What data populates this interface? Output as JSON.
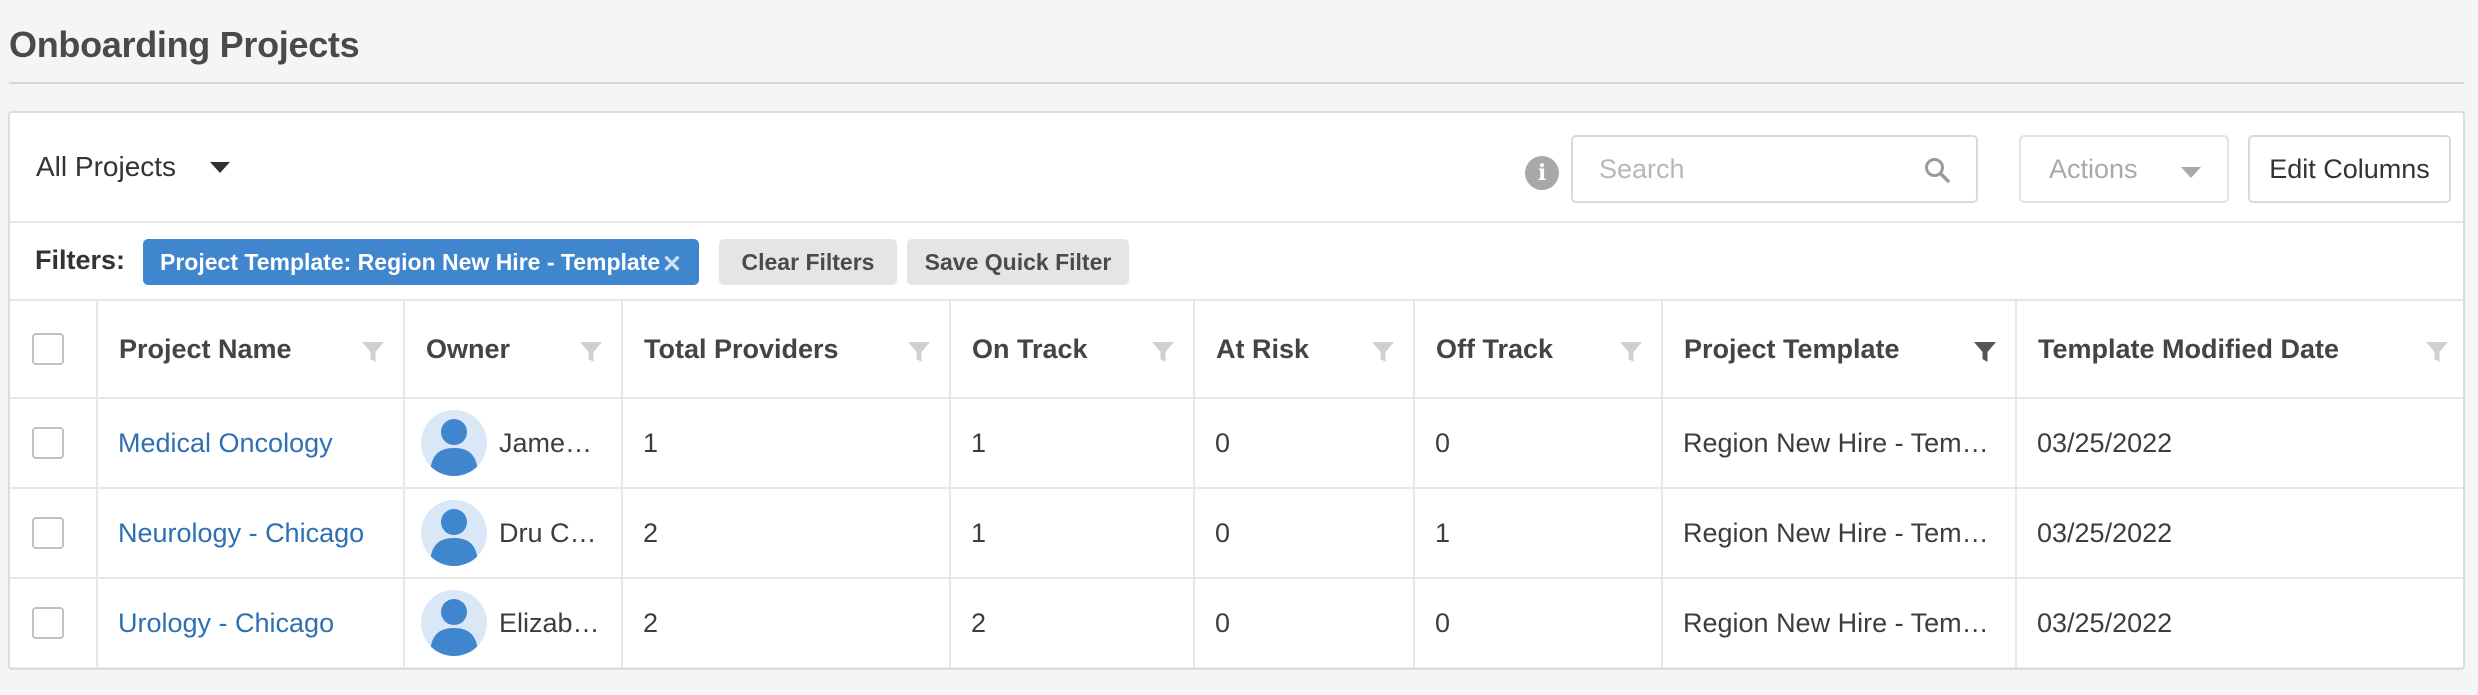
{
  "page": {
    "title": "Onboarding Projects"
  },
  "toolbar": {
    "view_label": "All Projects",
    "search_placeholder": "Search",
    "actions_label": "Actions",
    "edit_columns_label": "Edit Columns"
  },
  "filters": {
    "label": "Filters:",
    "active_chip": "Project Template: Region New Hire - Template",
    "chip_close": "✕",
    "clear_label": "Clear Filters",
    "save_label": "Save Quick Filter"
  },
  "table": {
    "columns": [
      "Project Name",
      "Owner",
      "Total Providers",
      "On Track",
      "At Risk",
      "Off Track",
      "Project Template",
      "Template Modified Date"
    ],
    "active_filter_column": "Project Template",
    "rows": [
      {
        "project_name": "Medical Oncology",
        "owner": "Jame…",
        "total_providers": "1",
        "on_track": "1",
        "at_risk": "0",
        "off_track": "0",
        "project_template": "Region New Hire - Tem…",
        "template_modified_date": "03/25/2022"
      },
      {
        "project_name": "Neurology - Chicago",
        "owner": "Dru C…",
        "total_providers": "2",
        "on_track": "1",
        "at_risk": "0",
        "off_track": "1",
        "project_template": "Region New Hire - Tem…",
        "template_modified_date": "03/25/2022"
      },
      {
        "project_name": "Urology - Chicago",
        "owner": "Elizab…",
        "total_providers": "2",
        "on_track": "2",
        "at_risk": "0",
        "off_track": "0",
        "project_template": "Region New Hire - Tem…",
        "template_modified_date": "03/25/2022"
      }
    ]
  },
  "colors": {
    "accent": "#3f86cf",
    "link": "#2f6fb3",
    "avatar_bg": "#d9e7f6",
    "avatar_fg": "#3f86cf",
    "filter_inactive": "#d0d0d0",
    "filter_active": "#555555"
  },
  "icons": {
    "view_caret": "chevron-down-icon",
    "info": "info-icon",
    "search": "search-icon",
    "actions_caret": "chevron-down-icon",
    "chip_remove": "close-icon",
    "column_filter": "funnel-icon",
    "owner_avatar": "user-avatar-icon"
  }
}
